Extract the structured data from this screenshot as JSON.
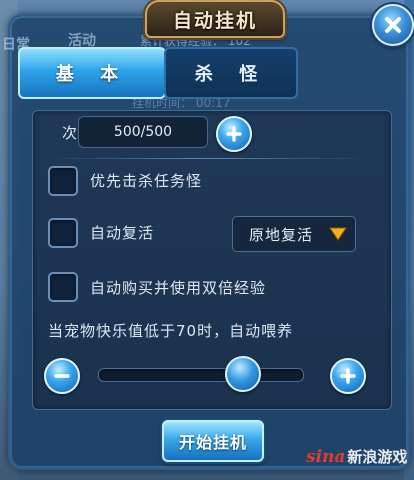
{
  "dialog": {
    "title": "自动挂机",
    "close_icon": "close-icon"
  },
  "tabs": [
    {
      "label": "基 本",
      "active": true
    },
    {
      "label": "杀 怪",
      "active": false
    }
  ],
  "background_text": {
    "daily": "日常",
    "activity": "活动",
    "exp_line": "累计获得经验：",
    "exp_value": "102",
    "time_line": "挂机时间：",
    "time_value": "00:17"
  },
  "settings": {
    "count_label": "次数",
    "count_value": "500/500",
    "options": [
      {
        "label": "优先击杀任务怪",
        "checked": false
      },
      {
        "label": "自动复活",
        "checked": false
      },
      {
        "label": "自动购买并使用双倍经验",
        "checked": false
      }
    ],
    "revive_select": {
      "value": "原地复活",
      "icon": "triangle-down-icon",
      "arrow_color": "#f2b21a"
    },
    "pet_feed_text": "当宠物快乐值低于70时，自动喂养",
    "pet_threshold": 70,
    "slider_fraction": 0.7
  },
  "actions": {
    "start_label": "开始挂机"
  },
  "watermark": {
    "logo": "sina",
    "text": "新浪游戏"
  },
  "colors": {
    "panel": "#21476e",
    "accent_blue": "#2fa4ea",
    "title_gold": "#c8a566"
  }
}
